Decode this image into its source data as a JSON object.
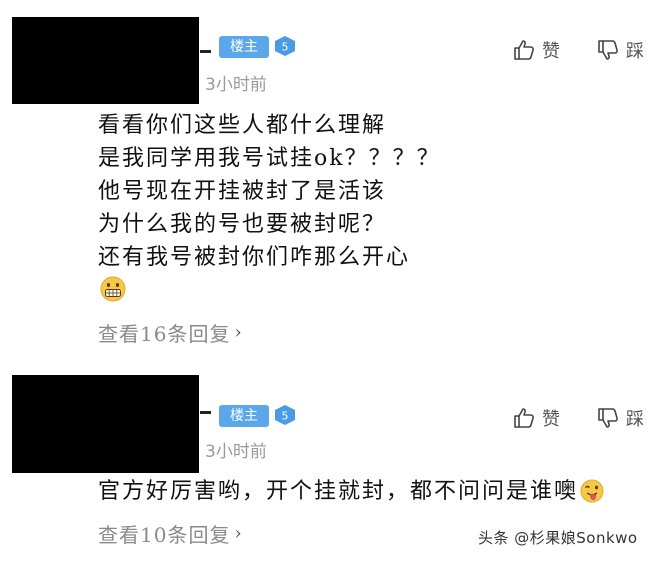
{
  "comments": [
    {
      "owner_badge": "楼主",
      "level": "5",
      "time": "3小时前",
      "like_label": "赞",
      "dislike_label": "踩",
      "lines": [
        "看看你们这些人都什么理解",
        "是我同学用我号试挂ok？？？？",
        "他号现在开挂被封了是活该",
        "为什么我的号也要被封呢？",
        "还有我号被封你们咋那么开心"
      ],
      "emoji": "grimacing-face-emoji",
      "replies_label": "查看16条回复",
      "chevron": "›"
    },
    {
      "owner_badge": "楼主",
      "level": "5",
      "time": "3小时前",
      "like_label": "赞",
      "dislike_label": "踩",
      "lines": [
        "官方好厉害哟，开个挂就封，都不问问是谁噢"
      ],
      "emoji": "tongue-out-face-emoji",
      "replies_label": "查看10条回复",
      "chevron": "›"
    }
  ],
  "watermark": "头条 @杉果娘Sonkwo",
  "colors": {
    "badge_blue": "#5aa7ea",
    "level_blue": "#4a9ae6",
    "meta_gray": "#9a9a9a",
    "emoji_yellow": "#f6c843"
  }
}
